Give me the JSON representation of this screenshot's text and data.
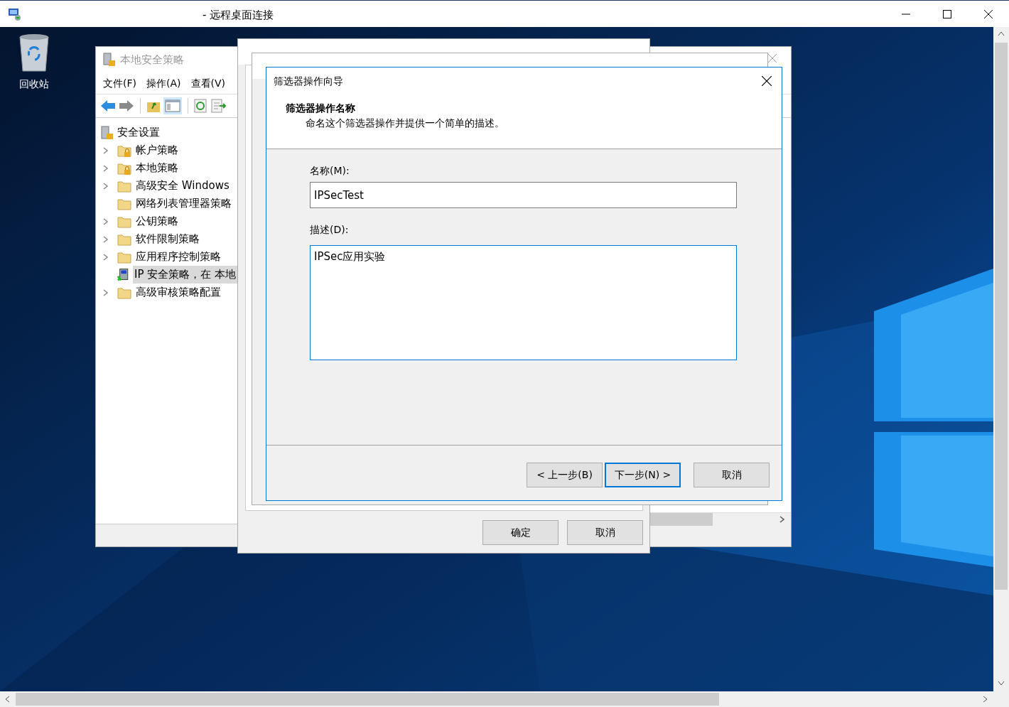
{
  "rdp_window": {
    "title": "- 远程桌面连接"
  },
  "desktop_icons": [
    {
      "label": "回收站",
      "kind": "recycle-bin"
    }
  ],
  "mmc": {
    "title": "本地安全策略",
    "menu": [
      "文件(F)",
      "操作(A)",
      "查看(V)"
    ],
    "tree": {
      "label": "安全设置",
      "children": [
        {
          "label": "帐户策略",
          "kind": "lock-folder",
          "expandable": true,
          "selected": false
        },
        {
          "label": "本地策略",
          "kind": "lock-folder",
          "expandable": true,
          "selected": false
        },
        {
          "label": "高级安全 Windows",
          "kind": "folder",
          "expandable": true,
          "selected": false
        },
        {
          "label": "网络列表管理器策略",
          "kind": "folder",
          "expandable": false,
          "selected": false
        },
        {
          "label": "公钥策略",
          "kind": "folder",
          "expandable": true,
          "selected": false
        },
        {
          "label": "软件限制策略",
          "kind": "folder",
          "expandable": true,
          "selected": false
        },
        {
          "label": "应用程序控制策略",
          "kind": "folder",
          "expandable": true,
          "selected": false
        },
        {
          "label": "IP 安全策略，在 本地",
          "kind": "ipsec",
          "expandable": false,
          "selected": true
        },
        {
          "label": "高级审核策略配置",
          "kind": "folder",
          "expandable": true,
          "selected": false
        }
      ]
    }
  },
  "properties_dialog": {
    "buttons": [
      "确定",
      "取消"
    ]
  },
  "filter_wizard": {
    "title": "筛选器操作向导",
    "heading": "筛选器操作名称",
    "subheading": "命名这个筛选器操作并提供一个简单的描述。",
    "name_label": "名称(M):",
    "name_value": "IPSecTest",
    "description_label": "描述(D):",
    "description_value": "IPSec应用实验",
    "buttons": [
      {
        "label": "< 上一步(B)",
        "default": false
      },
      {
        "label": "下一步(N) >",
        "default": true
      },
      {
        "label": "取消",
        "default": false
      }
    ]
  }
}
